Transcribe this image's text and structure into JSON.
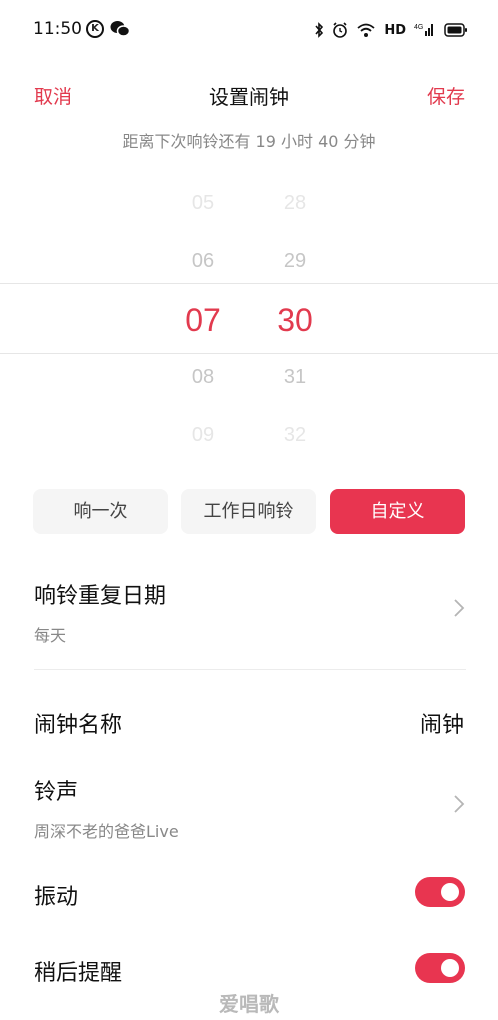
{
  "status_bar": {
    "time": "11:50",
    "k_badge": "K",
    "hd_label": "HD",
    "network_label": "4G"
  },
  "nav": {
    "cancel": "取消",
    "title": "设置闹钟",
    "save": "保存"
  },
  "countdown": "距离下次响铃还有  19 小时 40 分钟",
  "picker": {
    "hours": [
      "05",
      "06",
      "07",
      "08",
      "09"
    ],
    "minutes": [
      "28",
      "29",
      "30",
      "31",
      "32"
    ],
    "selected_hour": "07",
    "selected_minute": "30"
  },
  "modes": {
    "once": "响一次",
    "workday": "工作日响铃",
    "custom": "自定义",
    "active": "custom"
  },
  "repeat": {
    "title": "响铃重复日期",
    "value": "每天"
  },
  "alarm_name": {
    "title": "闹钟名称",
    "value": "闹钟"
  },
  "ringtone": {
    "title": "铃声",
    "value": "周深不老的爸爸Live"
  },
  "vibration": {
    "title": "振动",
    "on": true
  },
  "snooze": {
    "title": "稍后提醒",
    "on": true
  },
  "watermark": "爱唱歌",
  "colors": {
    "accent": "#e83550",
    "text_secondary": "#888888"
  }
}
